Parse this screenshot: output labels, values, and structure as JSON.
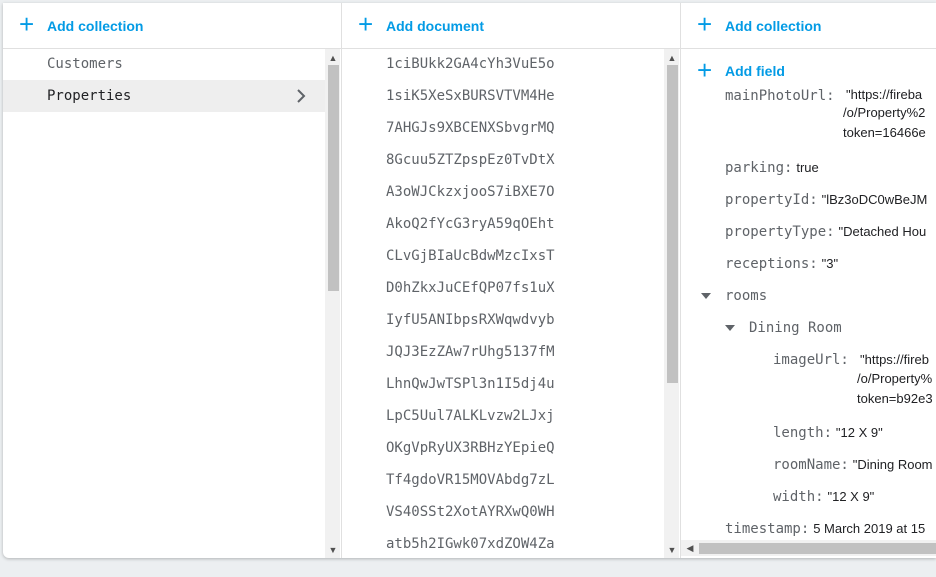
{
  "panel1": {
    "add_label": "Add collection",
    "items": [
      {
        "label": "Customers"
      },
      {
        "label": "Properties"
      }
    ]
  },
  "panel2": {
    "add_label": "Add document",
    "docs": [
      "1ciBUkk2GA4cYh3VuE5o",
      "1siK5XeSxBURSVTVM4He",
      "7AHGJs9XBCENXSbvgrMQ",
      "8Gcuu5ZTZpspEz0TvDtX",
      "A3oWJCkzxjooS7iBXE7O",
      "AkoQ2fYcG3ryA59qOEht",
      "CLvGjBIaUcBdwMzcIxsT",
      "D0hZkxJuCEfQP07fs1uX",
      "IyfU5ANIbpsRXWqwdvyb",
      "JQJ3EzZAw7rUhg5137fM",
      "LhnQwJwTSPl3n1I5dj4u",
      "LpC5Uul7ALKLvzw2LJxj",
      "OKgVpRyUX3RBHzYEpieQ",
      "Tf4gdoVR15MOVAbdg7zL",
      "VS40SSt2XotAYRXwQ0WH",
      "atb5h2IGwk07xdZOW4Za"
    ]
  },
  "panel3": {
    "add_collection_label": "Add collection",
    "add_field_label": "Add field",
    "mainPhoto": {
      "key": "mainPhotoUrl:",
      "line1": "\"https://fireba",
      "line2": "/o/Property%2",
      "line3": "token=16466e"
    },
    "parking": {
      "key": "parking:",
      "value": "true"
    },
    "propertyId": {
      "key": "propertyId:",
      "value": "\"lBz3oDC0wBeJM"
    },
    "propertyType": {
      "key": "propertyType:",
      "value": "\"Detached Hou"
    },
    "receptions": {
      "key": "receptions:",
      "value": "\"3\""
    },
    "rooms": {
      "key": "rooms"
    },
    "dining": {
      "key": "Dining Room"
    },
    "imageUrl": {
      "key": "imageUrl:",
      "line1": "\"https://fireb",
      "line2": "/o/Property%",
      "line3": "token=b92e3"
    },
    "length": {
      "key": "length:",
      "value": "\"12 X 9\""
    },
    "roomName": {
      "key": "roomName:",
      "value": "\"Dining Room"
    },
    "width": {
      "key": "width:",
      "value": "\"12 X 9\""
    },
    "timestamp": {
      "key": "timestamp:",
      "value": "5 March 2019 at 15"
    }
  },
  "colors": {
    "accent": "#039be5",
    "selected_bg": "#eeeeee"
  }
}
